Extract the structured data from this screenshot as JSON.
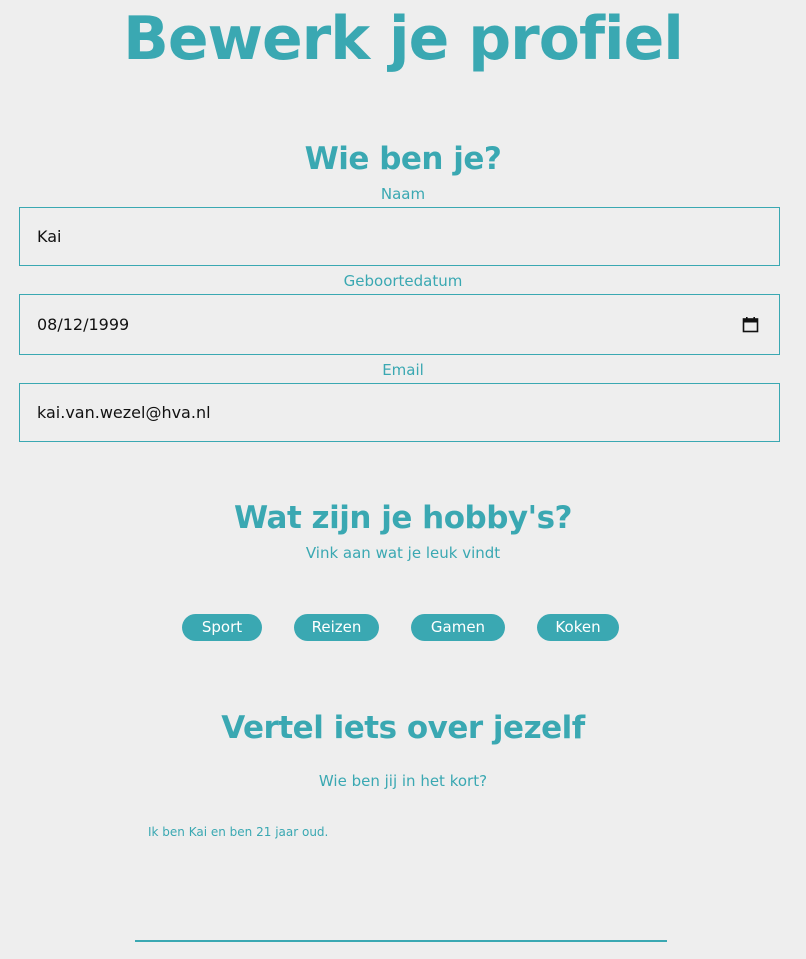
{
  "page": {
    "title": "Bewerk je profiel"
  },
  "who": {
    "heading": "Wie ben je?",
    "name": {
      "label": "Naam",
      "value": "Kai"
    },
    "birthdate": {
      "label": "Geboortedatum",
      "value": "08/12/1999",
      "icon": "calendar-icon"
    },
    "email": {
      "label": "Email",
      "value": "kai.van.wezel@hva.nl"
    }
  },
  "hobbies": {
    "heading": "Wat zijn je hobby's?",
    "subtitle": "Vink aan wat je leuk vindt",
    "items": [
      {
        "label": "Sport"
      },
      {
        "label": "Reizen"
      },
      {
        "label": "Gamen"
      },
      {
        "label": "Koken"
      }
    ]
  },
  "about": {
    "heading": "Vertel iets over jezelf",
    "subtitle": "Wie ben jij in het kort?",
    "value": "Ik ben Kai en ben 21 jaar oud."
  },
  "colors": {
    "accent": "#3aa8b2",
    "background": "#eeeeee",
    "input_text": "#111111",
    "pill_text": "#ffffff"
  }
}
